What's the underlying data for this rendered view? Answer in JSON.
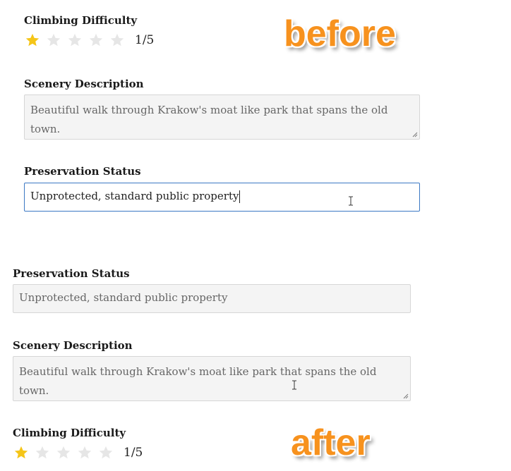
{
  "before": {
    "overlay_label": "before",
    "climbing": {
      "label": "Climbing Difficulty",
      "rating": 1,
      "max": 5,
      "score_text": "1/5"
    },
    "scenery": {
      "label": "Scenery Description",
      "value": "Beautiful walk through Krakow's moat like park that spans the old town."
    },
    "preservation": {
      "label": "Preservation Status",
      "value": "Unprotected, standard public property"
    }
  },
  "after": {
    "overlay_label": "after",
    "preservation": {
      "label": "Preservation Status",
      "value": "Unprotected, standard public property"
    },
    "scenery": {
      "label": "Scenery Description",
      "value": "Beautiful walk through Krakow's moat like park that spans the old town."
    },
    "climbing": {
      "label": "Climbing Difficulty",
      "rating": 1,
      "max": 5,
      "score_text": "1/5"
    }
  },
  "colors": {
    "star_filled": "#f5c518",
    "star_empty": "#e6e6e6",
    "overlay_text": "#f7921e",
    "active_border": "#3b78c4"
  }
}
